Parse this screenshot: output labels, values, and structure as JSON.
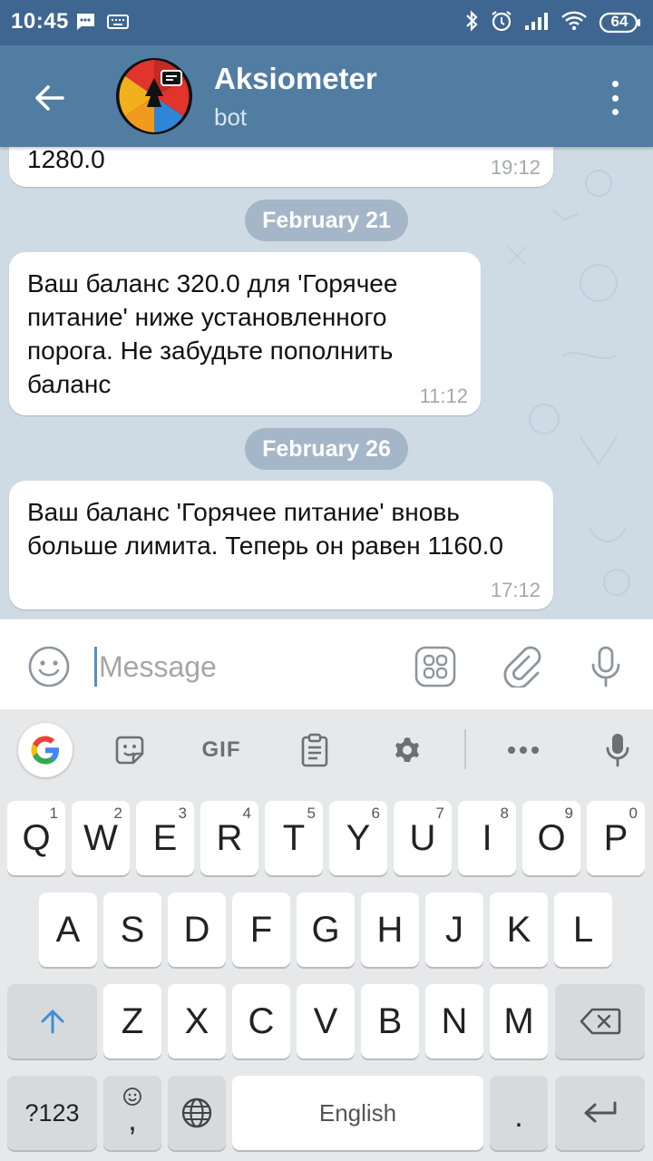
{
  "status_bar": {
    "time": "10:45",
    "battery": "64"
  },
  "header": {
    "title": "Aksiometer",
    "subtitle": "bot"
  },
  "messages": [
    {
      "text": "1280.0",
      "time": "19:12"
    },
    {
      "text": "Ваш баланс 320.0 для 'Горячее питание' ниже установленного порога. Не забудьте пополнить баланс",
      "time": "11:12"
    },
    {
      "text": "Ваш баланс 'Горячее питание' вновь больше лимита. Теперь он равен 1160.0",
      "time": "17:12"
    }
  ],
  "date_separators": [
    "February 21",
    "February 26"
  ],
  "input": {
    "placeholder": "Message"
  },
  "keyboard": {
    "row1": [
      {
        "key": "Q",
        "hint": "1"
      },
      {
        "key": "W",
        "hint": "2"
      },
      {
        "key": "E",
        "hint": "3"
      },
      {
        "key": "R",
        "hint": "4"
      },
      {
        "key": "T",
        "hint": "5"
      },
      {
        "key": "Y",
        "hint": "6"
      },
      {
        "key": "U",
        "hint": "7"
      },
      {
        "key": "I",
        "hint": "8"
      },
      {
        "key": "O",
        "hint": "9"
      },
      {
        "key": "P",
        "hint": "0"
      }
    ],
    "row2": [
      "A",
      "S",
      "D",
      "F",
      "G",
      "H",
      "J",
      "K",
      "L"
    ],
    "row3": [
      "Z",
      "X",
      "C",
      "V",
      "B",
      "N",
      "M"
    ],
    "symbols_label": "?123",
    "comma_label": ",",
    "space_label": "English",
    "period_label": ".",
    "toolbar_gif": "GIF"
  },
  "colors": {
    "header": "#527da3",
    "status_bar": "#3f6690",
    "chat_bg": "#cfdbe4",
    "accent": "#4a8ad0"
  }
}
